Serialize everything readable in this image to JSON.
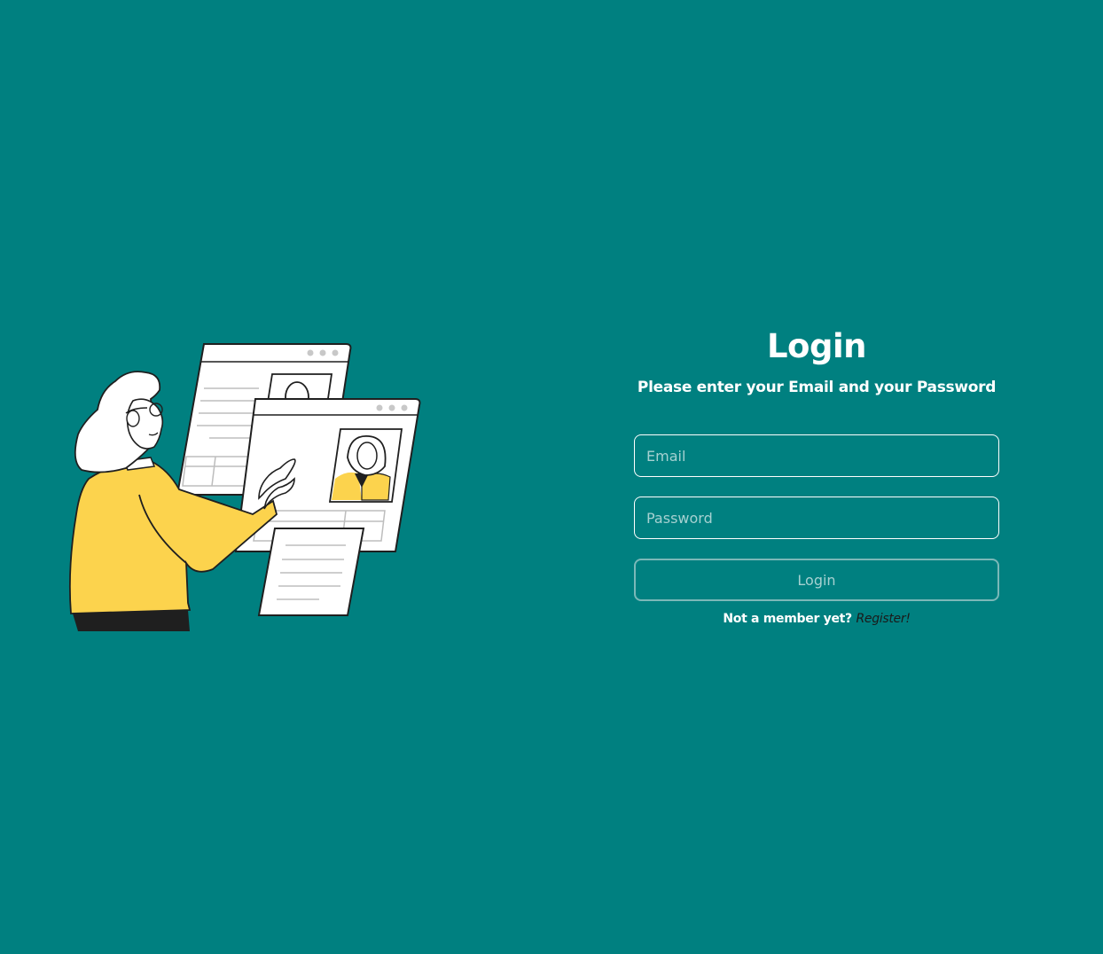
{
  "login": {
    "title": "Login",
    "subtitle": "Please enter your Email and your Password",
    "email_placeholder": "Email",
    "password_placeholder": "Password",
    "submit_label": "Login",
    "register_prompt": "Not a member yet?",
    "register_link": "Register!"
  },
  "colors": {
    "background": "#008080",
    "accent_yellow": "#FCD34D",
    "text": "#FFFFFF"
  }
}
